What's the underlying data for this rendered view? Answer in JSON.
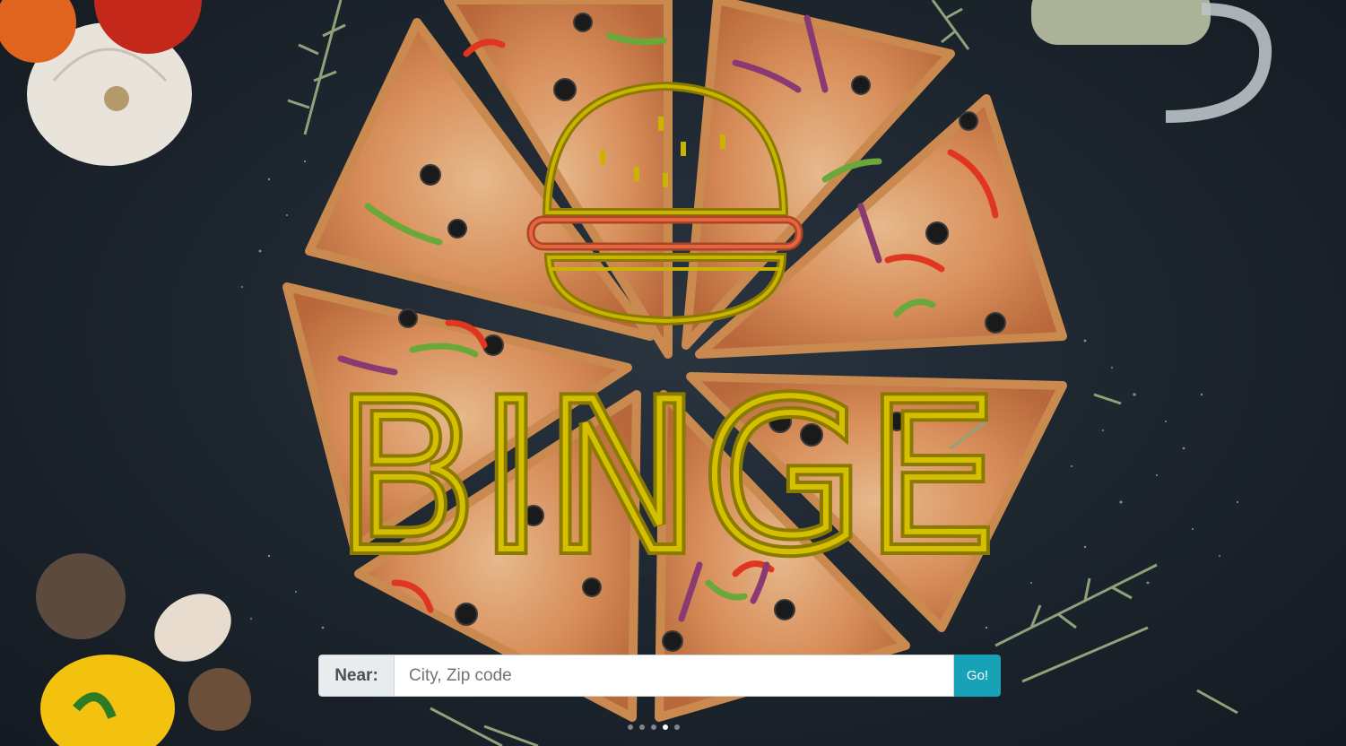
{
  "brand": {
    "name": "BINGE",
    "logo_icon": "burger-icon",
    "text_color": "#c9b400",
    "outline_color": "#8a7a00",
    "bun_line_color": "#e8643a"
  },
  "search": {
    "prefix_label": "Near:",
    "placeholder": "City, Zip code",
    "value": "",
    "submit_label": "Go!",
    "submit_color": "#17a2b8"
  },
  "carousel": {
    "slide_count": 5,
    "active_index": 3
  },
  "background": {
    "description_icon": "pizza-photo-icon",
    "base_color": "#1f2731"
  }
}
